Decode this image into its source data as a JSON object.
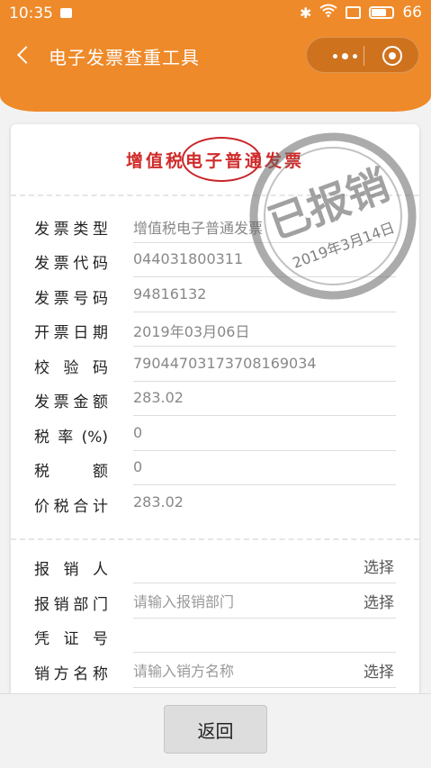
{
  "status_bar": {
    "time": "10:35",
    "battery": "66"
  },
  "nav": {
    "title": "电子发票查重工具"
  },
  "invoice": {
    "title": "增值税电子普通发票",
    "fields": [
      {
        "label": "发票类型",
        "value": "增值税电子普通发票"
      },
      {
        "label": "发票代码",
        "value": "044031800311"
      },
      {
        "label": "发票号码",
        "value": "94816132"
      },
      {
        "label": "开票日期",
        "value": "2019年03月06日"
      },
      {
        "label": "校 验 码",
        "value": "79044703173708169034"
      },
      {
        "label": "发票金额",
        "value": "283.02"
      },
      {
        "label": "税 率 (%)",
        "value": "0"
      },
      {
        "label": "税 额",
        "value": "0"
      },
      {
        "label": "价税合计",
        "value": "283.02"
      }
    ],
    "stamp": {
      "text": "已报销",
      "date": "2019年3月14日"
    }
  },
  "reimburse": {
    "reimburser": {
      "label": "报 销 人",
      "select": "选择"
    },
    "department": {
      "label": "报销部门",
      "placeholder": "请输入报销部门",
      "select": "选择"
    },
    "voucher": {
      "label": "凭 证 号"
    },
    "seller": {
      "label": "销方名称",
      "placeholder": "请输入销方名称",
      "select": "选择"
    }
  },
  "footer": {
    "return_label": "返回"
  },
  "colors": {
    "accent": "#ee8a2a",
    "stamp_red": "#d02a2a",
    "stamp_gray": "#555555"
  }
}
